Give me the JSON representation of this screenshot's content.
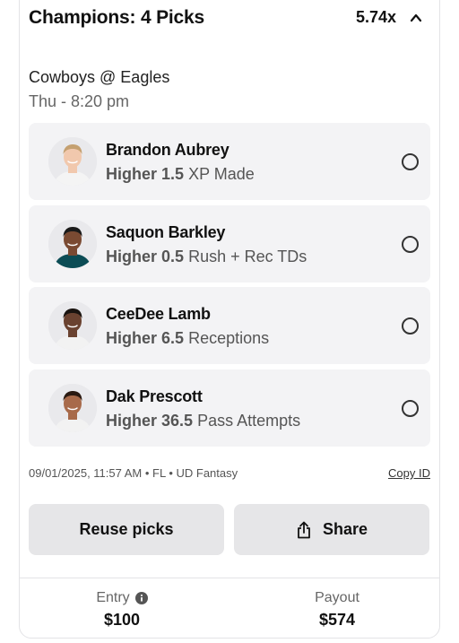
{
  "header": {
    "title": "Champions: 4 Picks",
    "multiplier": "5.74x"
  },
  "game": {
    "matchup": "Cowboys @ Eagles",
    "time": "Thu - 8:20 pm"
  },
  "picks": [
    {
      "name": "Brandon Aubrey",
      "direction": "Higher",
      "line": "1.5",
      "stat": "XP Made",
      "skin": "#f1c8ad",
      "hair": "#c4a070",
      "shirt": "#f4f4f4"
    },
    {
      "name": "Saquon Barkley",
      "direction": "Higher",
      "line": "0.5",
      "stat": "Rush + Rec TDs",
      "skin": "#7a4a32",
      "hair": "#1a1a1a",
      "shirt": "#0b4c55"
    },
    {
      "name": "CeeDee Lamb",
      "direction": "Higher",
      "line": "6.5",
      "stat": "Receptions",
      "skin": "#6a4230",
      "hair": "#1a1410",
      "shirt": "#f2f2f2"
    },
    {
      "name": "Dak Prescott",
      "direction": "Higher",
      "line": "36.5",
      "stat": "Pass Attempts",
      "skin": "#a86a4a",
      "hair": "#2a1a12",
      "shirt": "#f2f2f2"
    }
  ],
  "meta": {
    "info": "09/01/2025, 11:57 AM • FL • UD Fantasy",
    "copy_id": "Copy ID"
  },
  "actions": {
    "reuse_label": "Reuse picks",
    "share_label": "Share"
  },
  "footer": {
    "entry_label": "Entry",
    "entry_value": "$100",
    "payout_label": "Payout",
    "payout_value": "$574"
  },
  "icons": {
    "collapse": "chevron-up-icon",
    "share": "share-icon",
    "info": "info-icon"
  }
}
